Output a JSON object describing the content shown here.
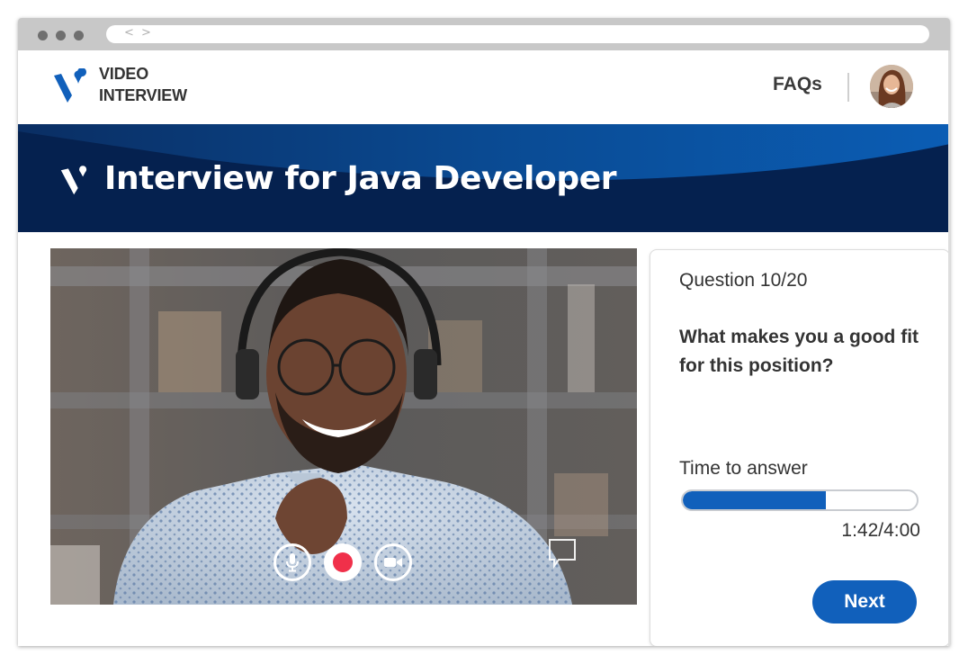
{
  "browser": {
    "window_dots": 3,
    "nav_arrows": "< >"
  },
  "header": {
    "brand_line1": "VIDEO",
    "brand_line2": "INTERVIEW",
    "faqs_label": "FAQs",
    "avatar_alt": "User profile"
  },
  "banner": {
    "title": "Interview for Java Developer"
  },
  "video": {
    "controls": [
      {
        "name": "microphone",
        "icon": "mic-icon"
      },
      {
        "name": "record",
        "icon": "record-icon"
      },
      {
        "name": "camera",
        "icon": "video-camera-icon"
      }
    ],
    "caption_icon": "speech-bubble-icon"
  },
  "question_panel": {
    "counter": "Question 10/20",
    "question_text": "What makes you a good fit for this position?",
    "time_label": "Time to answer",
    "time_value": "1:42/4:00",
    "progress_fraction": 0.61,
    "next_label": "Next"
  },
  "colors": {
    "brand_blue": "#1160bb",
    "banner_navy": "#05214f",
    "record_red": "#f0304a",
    "text_dark": "#333333"
  }
}
